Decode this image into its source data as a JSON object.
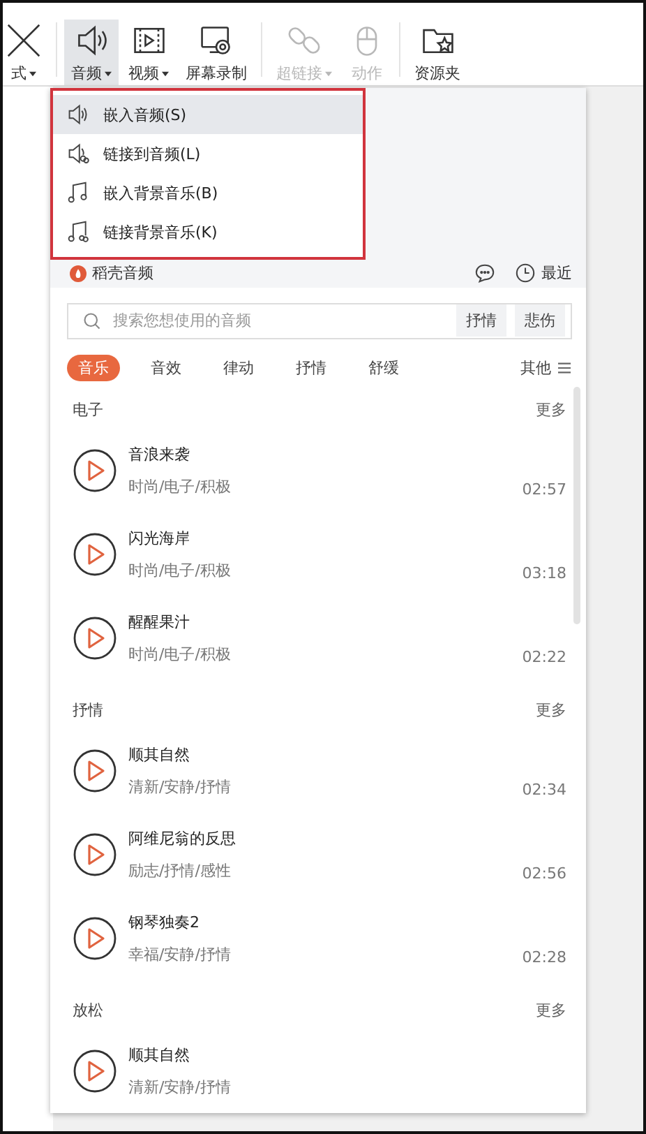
{
  "toolbar": {
    "items": [
      {
        "kind": "format",
        "label": "式",
        "caret": true,
        "selected": false,
        "disabled": false
      },
      {
        "kind": "audio",
        "label": "音频",
        "caret": true,
        "selected": true,
        "disabled": false
      },
      {
        "kind": "video",
        "label": "视频",
        "caret": true,
        "selected": false,
        "disabled": false
      },
      {
        "kind": "record",
        "label": "屏幕录制",
        "caret": false,
        "selected": false,
        "disabled": false
      },
      {
        "kind": "link",
        "label": "超链接",
        "caret": true,
        "selected": false,
        "disabled": true
      },
      {
        "kind": "action",
        "label": "动作",
        "caret": false,
        "selected": false,
        "disabled": true
      },
      {
        "kind": "folder",
        "label": "资源夹",
        "caret": false,
        "selected": false,
        "disabled": false
      }
    ]
  },
  "menu": {
    "items": [
      {
        "kind": "speaker",
        "label": "嵌入音频(S)",
        "selected": true
      },
      {
        "kind": "speaker-link",
        "label": "链接到音频(L)",
        "selected": false
      },
      {
        "kind": "note",
        "label": "嵌入背景音乐(B)",
        "selected": false
      },
      {
        "kind": "note-link",
        "label": "链接背景音乐(K)",
        "selected": false
      }
    ]
  },
  "panel": {
    "brand": "稻壳音频",
    "recent": "最近",
    "search": {
      "placeholder": "搜索您想使用的音频",
      "tags": [
        "抒情",
        "悲伤"
      ]
    },
    "tabs": [
      {
        "label": "音乐",
        "selected": true
      },
      {
        "label": "音效",
        "selected": false
      },
      {
        "label": "律动",
        "selected": false
      },
      {
        "label": "抒情",
        "selected": false
      },
      {
        "label": "舒缓",
        "selected": false
      }
    ],
    "other": "其他",
    "sections": [
      {
        "title": "电子",
        "more": "更多",
        "tracks": [
          {
            "title": "音浪来袭",
            "tags": "时尚/电子/积极",
            "duration": "02:57"
          },
          {
            "title": "闪光海岸",
            "tags": "时尚/电子/积极",
            "duration": "03:18"
          },
          {
            "title": "醒醒果汁",
            "tags": "时尚/电子/积极",
            "duration": "02:22"
          }
        ]
      },
      {
        "title": "抒情",
        "more": "更多",
        "tracks": [
          {
            "title": "顺其自然",
            "tags": "清新/安静/抒情",
            "duration": "02:34"
          },
          {
            "title": "阿维尼翁的反思",
            "tags": "励志/抒情/感性",
            "duration": "02:56"
          },
          {
            "title": "钢琴独奏2",
            "tags": "幸福/安静/抒情",
            "duration": "02:28"
          }
        ]
      },
      {
        "title": "放松",
        "more": "更多",
        "tracks": [
          {
            "title": "顺其自然",
            "tags": "清新/安静/抒情"
          }
        ]
      }
    ]
  }
}
